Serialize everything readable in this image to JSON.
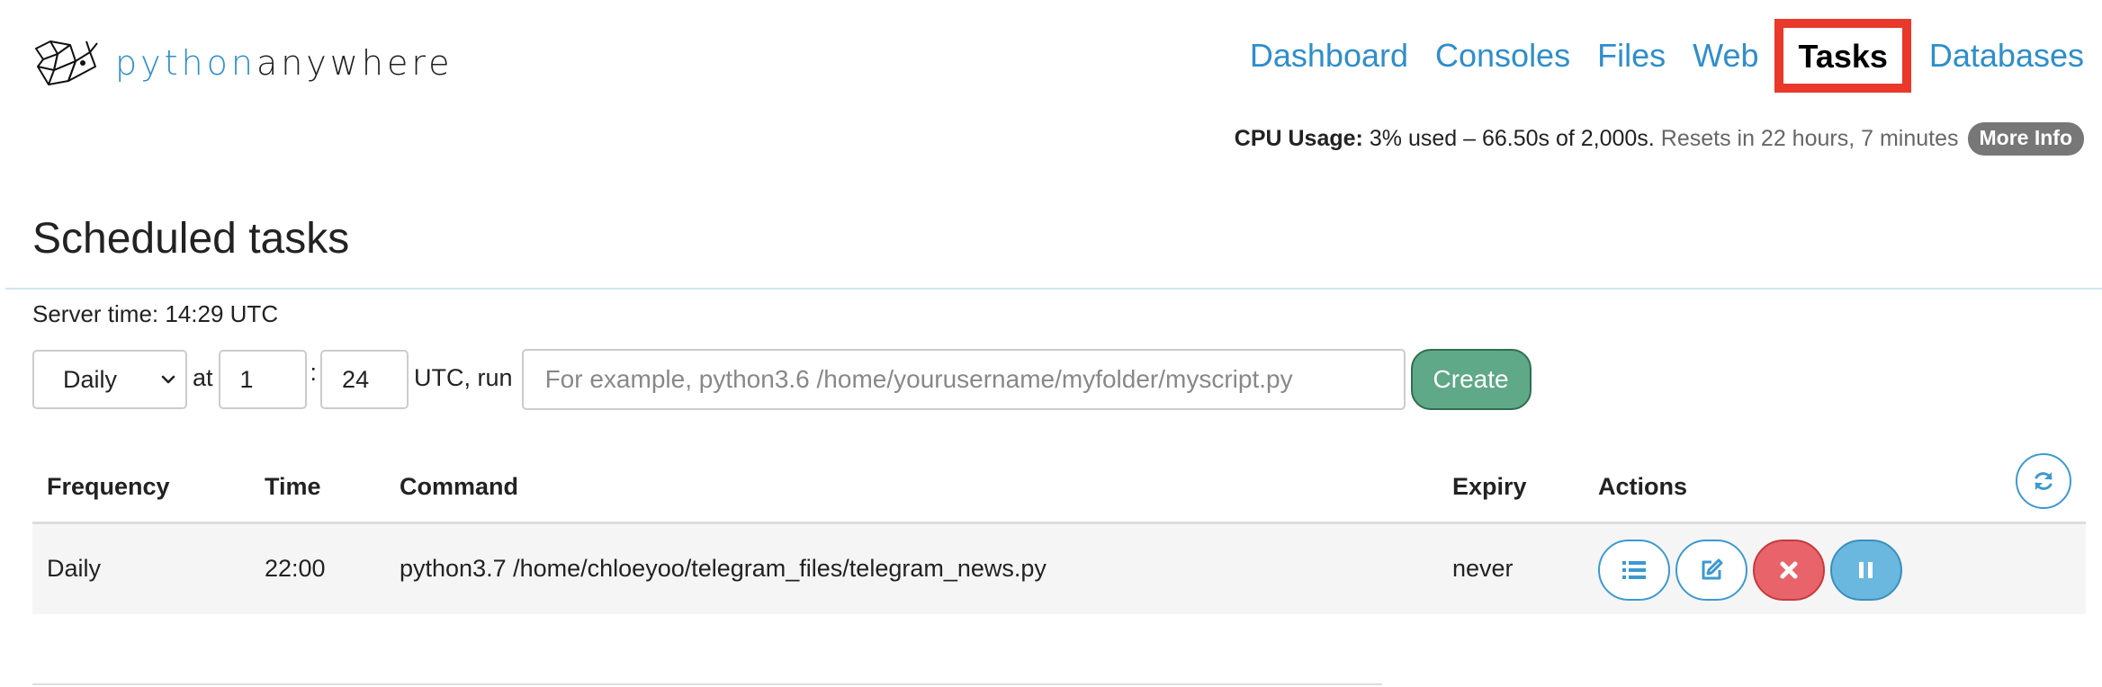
{
  "brand": {
    "logo_part1": "python",
    "logo_part2": "anywhere"
  },
  "nav": {
    "items": [
      {
        "label": "Dashboard",
        "active": false
      },
      {
        "label": "Consoles",
        "active": false
      },
      {
        "label": "Files",
        "active": false
      },
      {
        "label": "Web",
        "active": false
      },
      {
        "label": "Tasks",
        "active": true
      },
      {
        "label": "Databases",
        "active": false
      }
    ]
  },
  "cpu": {
    "label": "CPU Usage:",
    "usage": "3% used – 66.50s of 2,000s.",
    "reset": "Resets in 22 hours, 7 minutes",
    "more_info": "More Info"
  },
  "page": {
    "title": "Scheduled tasks",
    "server_time": "Server time: 14:29 UTC"
  },
  "form": {
    "frequency": "Daily",
    "at_label": "at",
    "hour": "1",
    "colon": ":",
    "minute": "24",
    "utc_run_label": "UTC, run",
    "command_placeholder": "For example, python3.6 /home/yourusername/myfolder/myscript.py",
    "create_label": "Create"
  },
  "table": {
    "headers": {
      "frequency": "Frequency",
      "time": "Time",
      "command": "Command",
      "expiry": "Expiry",
      "actions": "Actions"
    },
    "rows": [
      {
        "frequency": "Daily",
        "time": "22:00",
        "command": "python3.7 /home/chloeyoo/telegram_files/telegram_news.py",
        "expiry": "never",
        "actions": [
          "list-icon",
          "edit-icon",
          "delete-icon",
          "pause-icon"
        ]
      }
    ]
  },
  "colors": {
    "accent": "#2f8ecb",
    "active_nav_border": "#e8392a",
    "create_button": "#5fa888",
    "delete_button": "#e8646a",
    "pause_button": "#6ab8df"
  }
}
